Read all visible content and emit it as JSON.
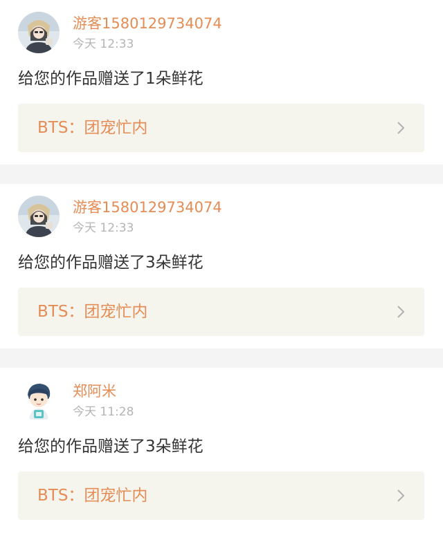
{
  "colors": {
    "accent": "#e58c55",
    "time_gray": "#b5b5b5",
    "message_text": "#333333",
    "link_bg": "#f5f5ee",
    "separator": "#f4f4f4"
  },
  "notifications": [
    {
      "username": "游客1580129734074",
      "time": "今天 12:33",
      "message": "给您的作品赠送了1朵鲜花",
      "work_title": "BTS：团宠忙内",
      "avatar_icon": "girl-photo-avatar-icon",
      "link_icon": "chevron-right-icon"
    },
    {
      "username": "游客1580129734074",
      "time": "今天 12:33",
      "message": "给您的作品赠送了3朵鲜花",
      "work_title": "BTS：团宠忙内",
      "avatar_icon": "girl-photo-avatar-icon",
      "link_icon": "chevron-right-icon"
    },
    {
      "username": "郑阿米",
      "time": "今天 11:28",
      "message": "给您的作品赠送了3朵鲜花",
      "work_title": "BTS：团宠忙内",
      "avatar_icon": "cartoon-boy-avatar-icon",
      "link_icon": "chevron-right-icon"
    }
  ]
}
